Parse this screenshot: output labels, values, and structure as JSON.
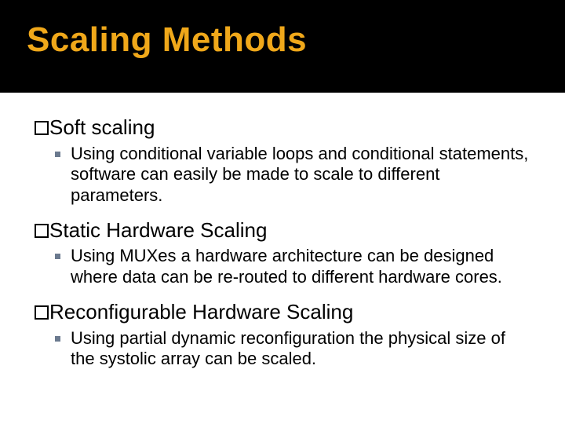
{
  "title": "Scaling Methods",
  "sections": [
    {
      "heading": "Soft scaling",
      "body": "Using conditional variable loops and conditional statements, software can easily be made to scale to different parameters."
    },
    {
      "heading": "Static Hardware Scaling",
      "body": "Using MUXes a hardware architecture can be designed where data can be re-routed to different hardware cores."
    },
    {
      "heading": "Reconfigurable Hardware Scaling",
      "body": "Using partial dynamic reconfiguration the physical size of the systolic array can be scaled."
    }
  ]
}
